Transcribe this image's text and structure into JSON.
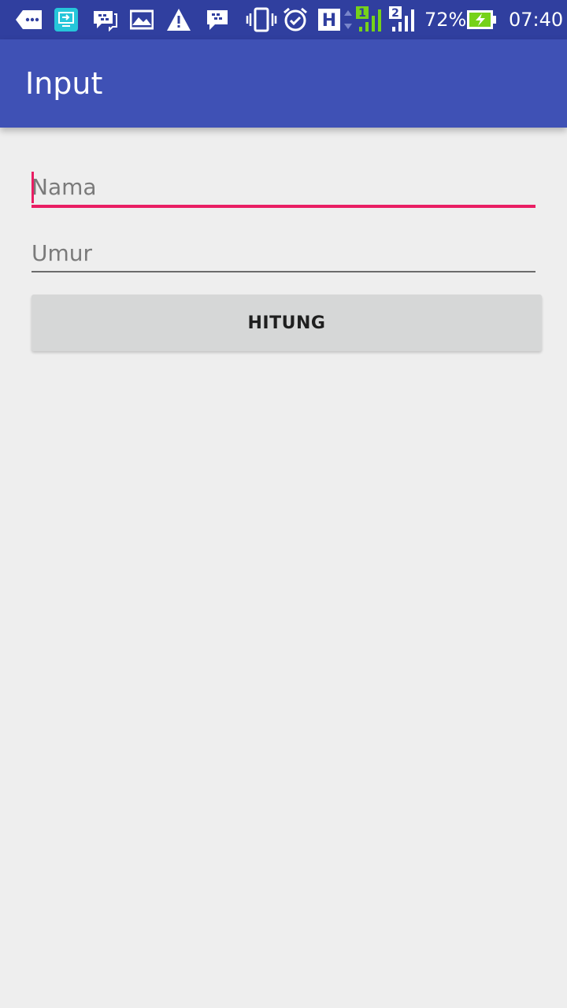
{
  "status_bar": {
    "battery_percent": "72%",
    "time": "07:40",
    "network_type": "H",
    "sim1_label": "1",
    "sim2_label": "2",
    "icons": [
      "messaging-icon",
      "screen-mirror-icon",
      "bbm-icon",
      "gallery-icon",
      "warning-icon",
      "bbm-chat-icon",
      "vibrate-icon",
      "alarm-icon",
      "network-h-icon",
      "signal-sim1-icon",
      "signal-sim2-icon",
      "battery-charging-icon"
    ]
  },
  "app_bar": {
    "title": "Input",
    "color": "#3f51b5"
  },
  "form": {
    "name_placeholder": "Nama",
    "age_placeholder": "Umur",
    "name_value": "",
    "age_value": "",
    "accent_color": "#e91e63"
  },
  "button": {
    "label": "HITUNG"
  }
}
